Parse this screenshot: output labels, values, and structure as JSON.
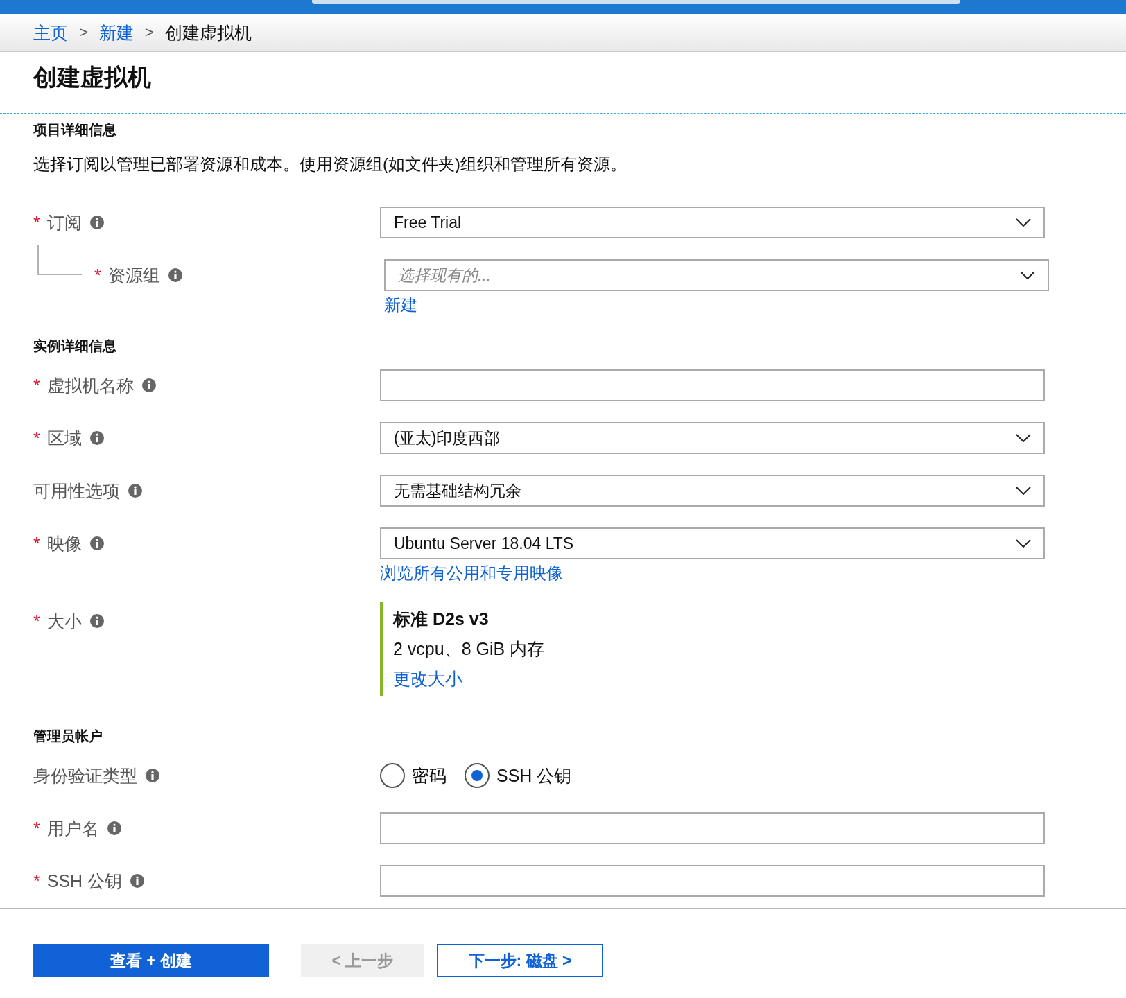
{
  "breadcrumb": [
    {
      "label": "主页",
      "link": true
    },
    {
      "label": "新建",
      "link": true
    },
    {
      "label": "创建虚拟机",
      "link": false
    }
  ],
  "breadcrumb_separator": ">",
  "page_title": "创建虚拟机",
  "sections": [
    {
      "heading": "项目详细信息",
      "description": "选择订阅以管理已部署资源和成本。使用资源组(如文件夹)组织和管理所有资源。",
      "fields": [
        {
          "kind": "select",
          "label": "订阅",
          "required": true,
          "value": "Free Trial",
          "children": [
            {
              "kind": "select",
              "label": "资源组",
              "required": true,
              "placeholder": "选择现有的...",
              "link": "新建"
            }
          ]
        }
      ]
    },
    {
      "heading": "实例详细信息",
      "fields": [
        {
          "kind": "text",
          "label": "虚拟机名称",
          "required": true
        },
        {
          "kind": "select",
          "label": "区域",
          "required": true,
          "value": "(亚太)印度西部"
        },
        {
          "kind": "select",
          "label": "可用性选项",
          "required": false,
          "value": "无需基础结构冗余"
        },
        {
          "kind": "select",
          "label": "映像",
          "required": true,
          "value": "Ubuntu Server 18.04 LTS",
          "link": "浏览所有公用和专用映像"
        },
        {
          "kind": "size",
          "label": "大小",
          "required": true,
          "size_name": "标准 D2s v3",
          "size_spec": "2 vcpu、8 GiB 内存",
          "link": "更改大小"
        }
      ]
    },
    {
      "heading": "管理员帐户",
      "fields": [
        {
          "kind": "radio",
          "label": "身份验证类型",
          "required": false,
          "options": [
            {
              "label": "密码",
              "selected": false
            },
            {
              "label": "SSH 公钥",
              "selected": true
            }
          ]
        },
        {
          "kind": "text",
          "label": "用户名",
          "required": true
        },
        {
          "kind": "text",
          "label": "SSH 公钥",
          "required": true
        }
      ]
    }
  ],
  "required_mark": "*",
  "buttons": [
    {
      "label": "查看 + 创建",
      "kind": "primary",
      "disabled": false
    },
    {
      "label": "< 上一步",
      "kind": "secondary",
      "disabled": true
    },
    {
      "label": "下一步: 磁盘 >",
      "kind": "outline",
      "disabled": false
    }
  ]
}
